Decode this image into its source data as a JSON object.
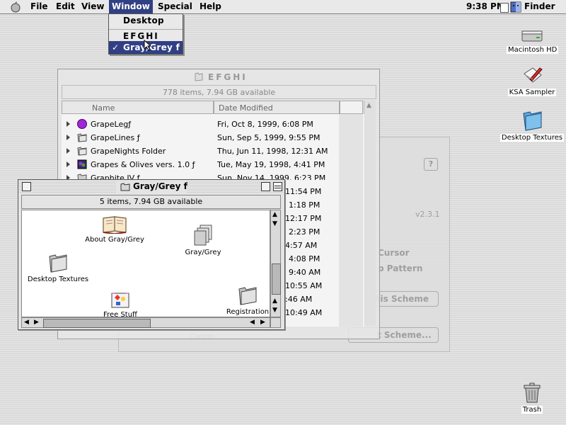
{
  "menubar": {
    "items": [
      "File",
      "Edit",
      "View",
      "Window",
      "Special",
      "Help"
    ],
    "active": "Window",
    "clock": "9:38 PM",
    "app": "Finder"
  },
  "window_menu": {
    "items": [
      "Desktop",
      "EFGHI",
      "Gray/Grey f"
    ],
    "checked": "Gray/Grey f",
    "check_mark": "✓"
  },
  "desktop_icons": [
    {
      "label": "Macintosh HD",
      "icon": "hard-disk-icon"
    },
    {
      "label": "KSA Sampler",
      "icon": "document-pen-icon"
    },
    {
      "label": "Desktop Textures",
      "icon": "folder-icon"
    },
    {
      "label": "Trash",
      "icon": "trash-icon"
    }
  ],
  "efghi_window": {
    "title": "EFGHI",
    "info": "778 items, 7.94 GB available",
    "columns": {
      "name": "Name",
      "date": "Date Modified"
    },
    "rows": [
      {
        "name": "GrapeLegƒ",
        "date": "Fri, Oct 8, 1999, 6:08 PM",
        "icon": "purple-circle-icon"
      },
      {
        "name": "GrapeLines ƒ",
        "date": "Sun, Sep 5, 1999, 9:55 PM",
        "icon": "folder-icon"
      },
      {
        "name": "GrapeNights Folder",
        "date": "Thu, Jun 11, 1998, 12:31 AM",
        "icon": "folder-icon"
      },
      {
        "name": "Grapes & Olives vers. 1.0 ƒ",
        "date": "Tue, May 19, 1998, 4:41 PM",
        "icon": "app-icon"
      },
      {
        "name": "Graphite IV ƒ",
        "date": "Sun, Nov 14, 1999, 6:23 PM",
        "icon": "folder-icon"
      }
    ],
    "hidden_times": [
      "11:54 PM",
      "1:18 PM",
      "12:17 PM",
      "2:23 PM",
      "4:57 AM",
      "4:08 PM",
      "9:40 AM",
      "10:55 AM",
      ":46 AM",
      "10:49 AM"
    ]
  },
  "control_panel_ghost": {
    "version": "v2.3.1",
    "labels": [
      "Cursor",
      "p Pattern",
      "his Scheme",
      "t Scheme...",
      "Cancel"
    ],
    "help": "?"
  },
  "gray_window": {
    "title": "Gray/Grey f",
    "info": "5 items, 7.94 GB available",
    "icons": [
      {
        "label": "About Gray/Grey",
        "icon": "book-icon"
      },
      {
        "label": "Gray/Grey",
        "icon": "stacked-pages-icon"
      },
      {
        "label": "Desktop Textures",
        "icon": "folder-icon"
      },
      {
        "label": "Free Stuff",
        "icon": "colorful-doc-icon"
      },
      {
        "label": "Registration",
        "icon": "folder-icon"
      }
    ]
  }
}
